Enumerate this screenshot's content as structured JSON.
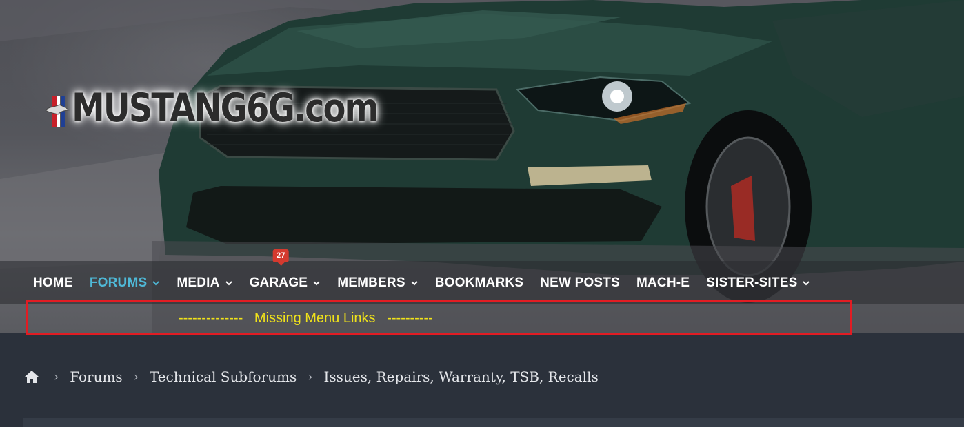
{
  "logo": {
    "text": "MUSTANG6G.com"
  },
  "nav": {
    "items": [
      {
        "label": "HOME",
        "dropdown": false,
        "active": false
      },
      {
        "label": "FORUMS",
        "dropdown": true,
        "active": true
      },
      {
        "label": "MEDIA",
        "dropdown": true,
        "active": false
      },
      {
        "label": "GARAGE",
        "dropdown": true,
        "active": false,
        "badge": "27"
      },
      {
        "label": "MEMBERS",
        "dropdown": true,
        "active": false
      },
      {
        "label": "BOOKMARKS",
        "dropdown": false,
        "active": false
      },
      {
        "label": "NEW POSTS",
        "dropdown": false,
        "active": false
      },
      {
        "label": "MACH-E",
        "dropdown": false,
        "active": false
      },
      {
        "label": "SISTER-SITES",
        "dropdown": true,
        "active": false
      }
    ]
  },
  "annotation": {
    "text": "--------------   Missing Menu Links   ----------"
  },
  "breadcrumb": {
    "items": [
      "Forums",
      "Technical Subforums",
      "Issues, Repairs, Warranty, TSB, Recalls"
    ]
  },
  "colors": {
    "accent": "#4fb8d6",
    "badge": "#d43a2f",
    "annotation_border": "#e21c23",
    "annotation_text": "#f0e21a",
    "page_background": "#2b313b"
  }
}
